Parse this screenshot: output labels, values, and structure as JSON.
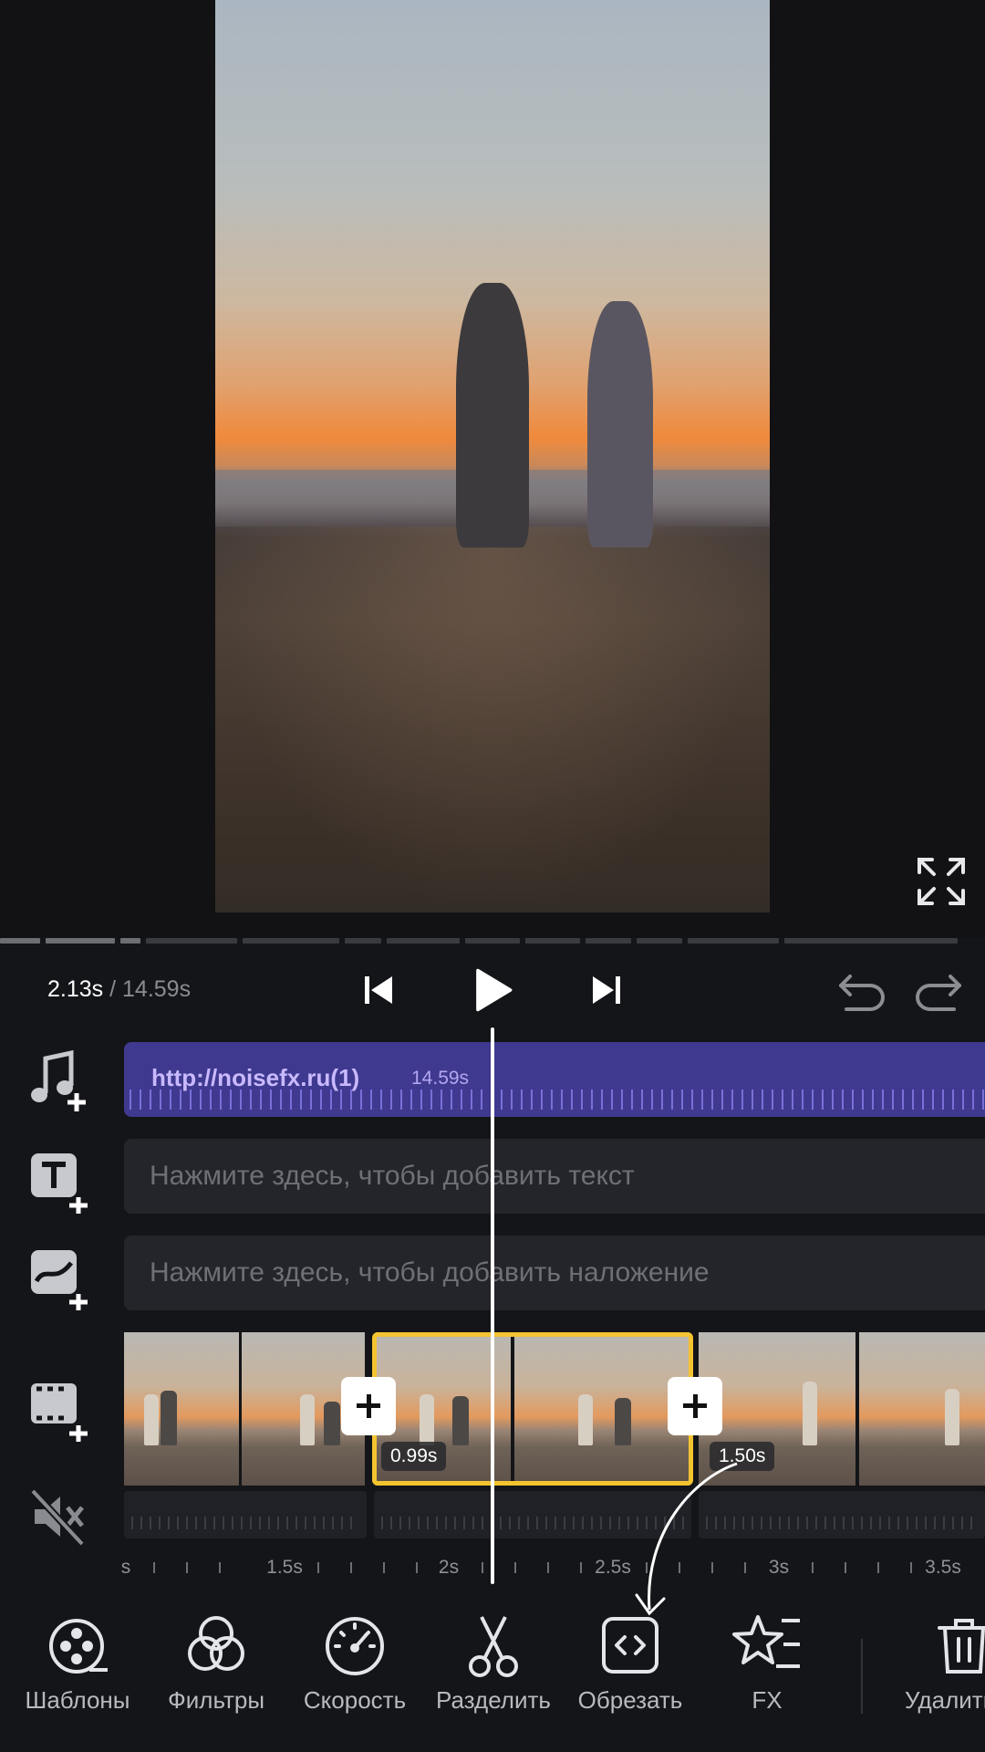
{
  "player": {
    "current_time": "2.13s",
    "separator": " / ",
    "total_time": "14.59s"
  },
  "tracks": {
    "audio": {
      "label": "http://noisefx.ru(1)",
      "duration": "14.59s"
    },
    "text": {
      "placeholder": "Нажмите здесь, чтобы добавить текст"
    },
    "overlay": {
      "placeholder": "Нажмите здесь, чтобы добавить наложение"
    }
  },
  "clips": {
    "selected_duration": "0.99s",
    "next_duration": "1.50s"
  },
  "ruler": {
    "labels": [
      "s",
      "1.5s",
      "2s",
      "2.5s",
      "3s",
      "3.5s"
    ]
  },
  "toolbar": {
    "items": [
      {
        "label": "Шаблоны",
        "icon": "templates-icon"
      },
      {
        "label": "Фильтры",
        "icon": "filters-icon"
      },
      {
        "label": "Скорость",
        "icon": "speed-icon"
      },
      {
        "label": "Разделить",
        "icon": "scissors-icon"
      },
      {
        "label": "Обрезать",
        "icon": "trim-icon"
      },
      {
        "label": "FX",
        "icon": "fx-star-icon"
      },
      {
        "label": "Удалить",
        "icon": "trash-icon"
      }
    ]
  },
  "colors": {
    "background": "#141518",
    "audio_track": "#3f3a8f",
    "selection": "#f4c430",
    "accent_text": "#c9b9ff"
  }
}
